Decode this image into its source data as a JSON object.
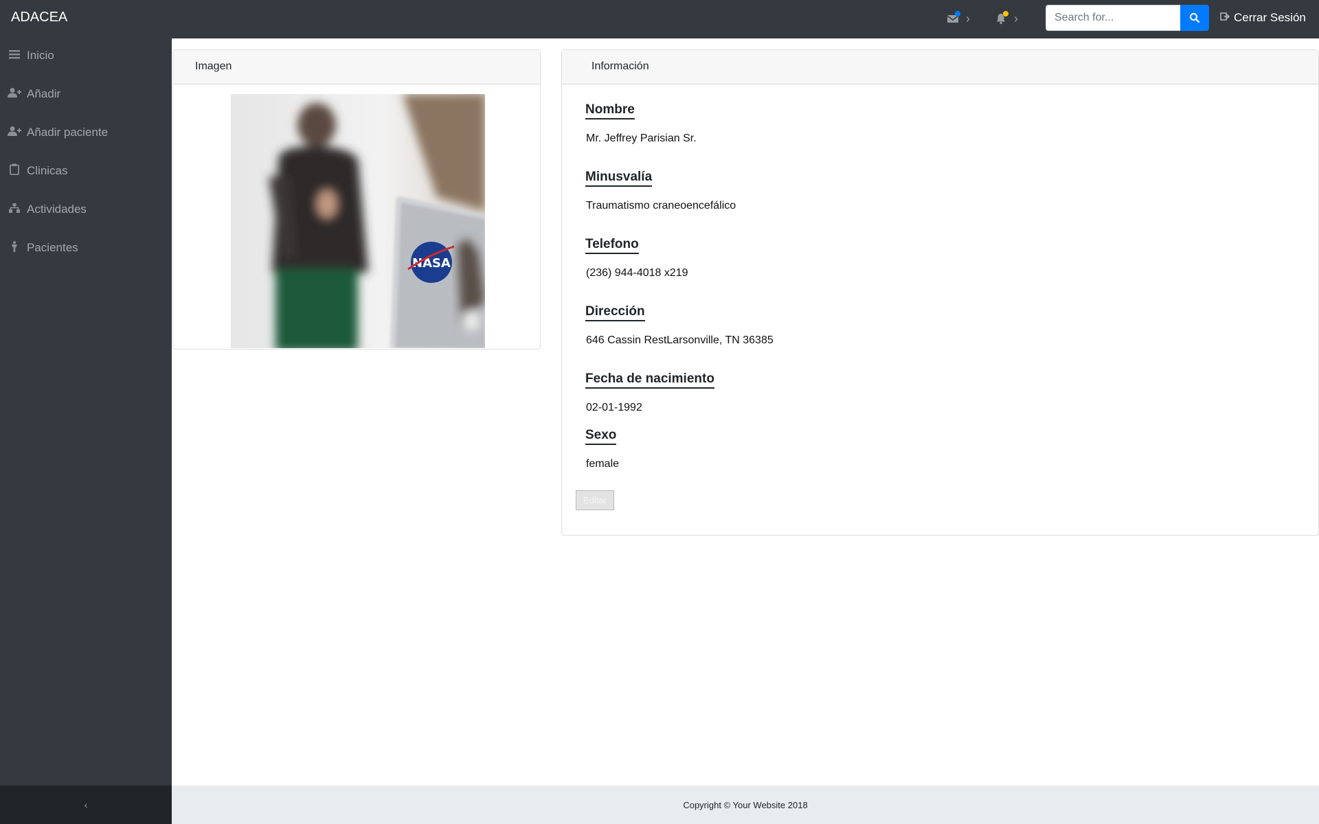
{
  "navbar": {
    "brand": "ADACEA",
    "messages_icon": "envelope-icon",
    "messages_dot_color": "#007bff",
    "alerts_icon": "bell-icon",
    "alerts_dot_color": "#ffc107",
    "search_placeholder": "Search for...",
    "search_value": "",
    "logout_label": "Cerrar Sesión"
  },
  "sidebar": {
    "items": [
      {
        "label": "Inicio",
        "icon": "bars-icon"
      },
      {
        "label": "Añadir",
        "icon": "user-plus-icon"
      },
      {
        "label": "Añadir paciente",
        "icon": "user-plus-icon"
      },
      {
        "label": "Clinicas",
        "icon": "clipboard-icon"
      },
      {
        "label": "Actividades",
        "icon": "sitemap-icon"
      },
      {
        "label": "Pacientes",
        "icon": "person-icon"
      }
    ],
    "toggle_glyph": "‹"
  },
  "image_card": {
    "header": "Imagen"
  },
  "info_card": {
    "header": "Información",
    "fields": [
      {
        "title": "Nombre",
        "value": "Mr. Jeffrey Parisian Sr."
      },
      {
        "title": "Minusvalía",
        "value": "Traumatismo craneoencefálico"
      },
      {
        "title": "Telefono",
        "value": "(236) 944-4018 x219"
      },
      {
        "title": "Dirección",
        "value": "646 Cassin RestLarsonville, TN 36385"
      },
      {
        "title": "Fecha de nacimiento",
        "value": "02-01-1992"
      },
      {
        "title": "Sexo",
        "value": "female"
      }
    ],
    "edit_label": "Editar"
  },
  "footer": {
    "copyright": "Copyright © Your Website 2018"
  }
}
